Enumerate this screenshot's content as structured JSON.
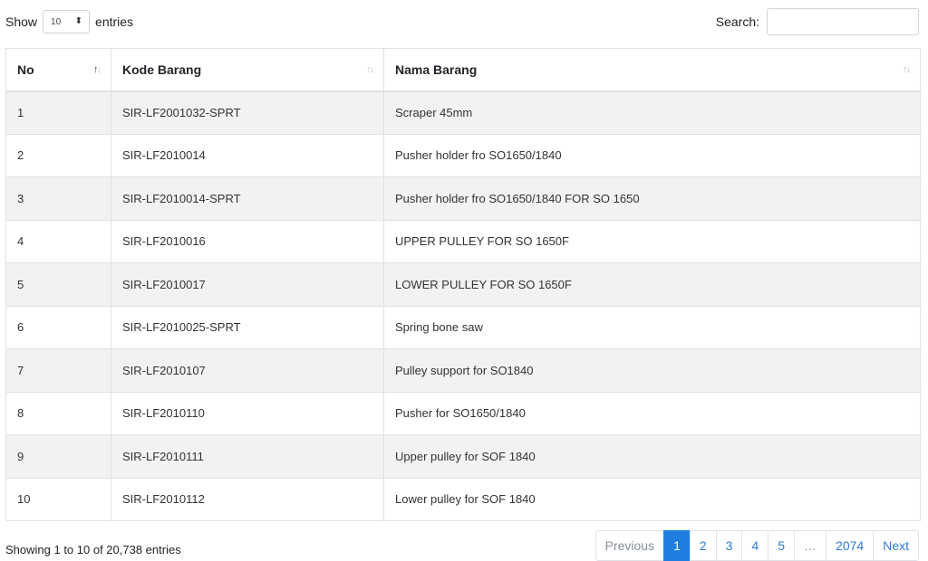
{
  "length": {
    "show_label": "Show",
    "value": "10",
    "entries_label": "entries"
  },
  "search": {
    "label": "Search:",
    "value": ""
  },
  "table": {
    "columns": [
      "No",
      "Kode Barang",
      "Nama Barang"
    ],
    "rows": [
      [
        "1",
        "SIR-LF2001032-SPRT",
        "Scraper 45mm"
      ],
      [
        "2",
        "SIR-LF2010014",
        "Pusher holder fro SO1650/1840"
      ],
      [
        "3",
        "SIR-LF2010014-SPRT",
        "Pusher holder fro SO1650/1840 FOR SO 1650"
      ],
      [
        "4",
        "SIR-LF2010016",
        "UPPER PULLEY FOR SO 1650F"
      ],
      [
        "5",
        "SIR-LF2010017",
        "LOWER PULLEY FOR SO 1650F"
      ],
      [
        "6",
        "SIR-LF2010025-SPRT",
        "Spring bone saw"
      ],
      [
        "7",
        "SIR-LF2010107",
        "Pulley support for SO1840"
      ],
      [
        "8",
        "SIR-LF2010110",
        "Pusher for SO1650/1840"
      ],
      [
        "9",
        "SIR-LF2010111",
        "Upper pulley for SOF 1840"
      ],
      [
        "10",
        "SIR-LF2010112",
        "Lower pulley for SOF 1840"
      ]
    ]
  },
  "info": "Showing 1 to 10 of 20,738 entries",
  "pagination": {
    "previous": "Previous",
    "pages": [
      "1",
      "2",
      "3",
      "4",
      "5"
    ],
    "ellipsis": "…",
    "last_page": "2074",
    "next": "Next",
    "active": "1"
  }
}
